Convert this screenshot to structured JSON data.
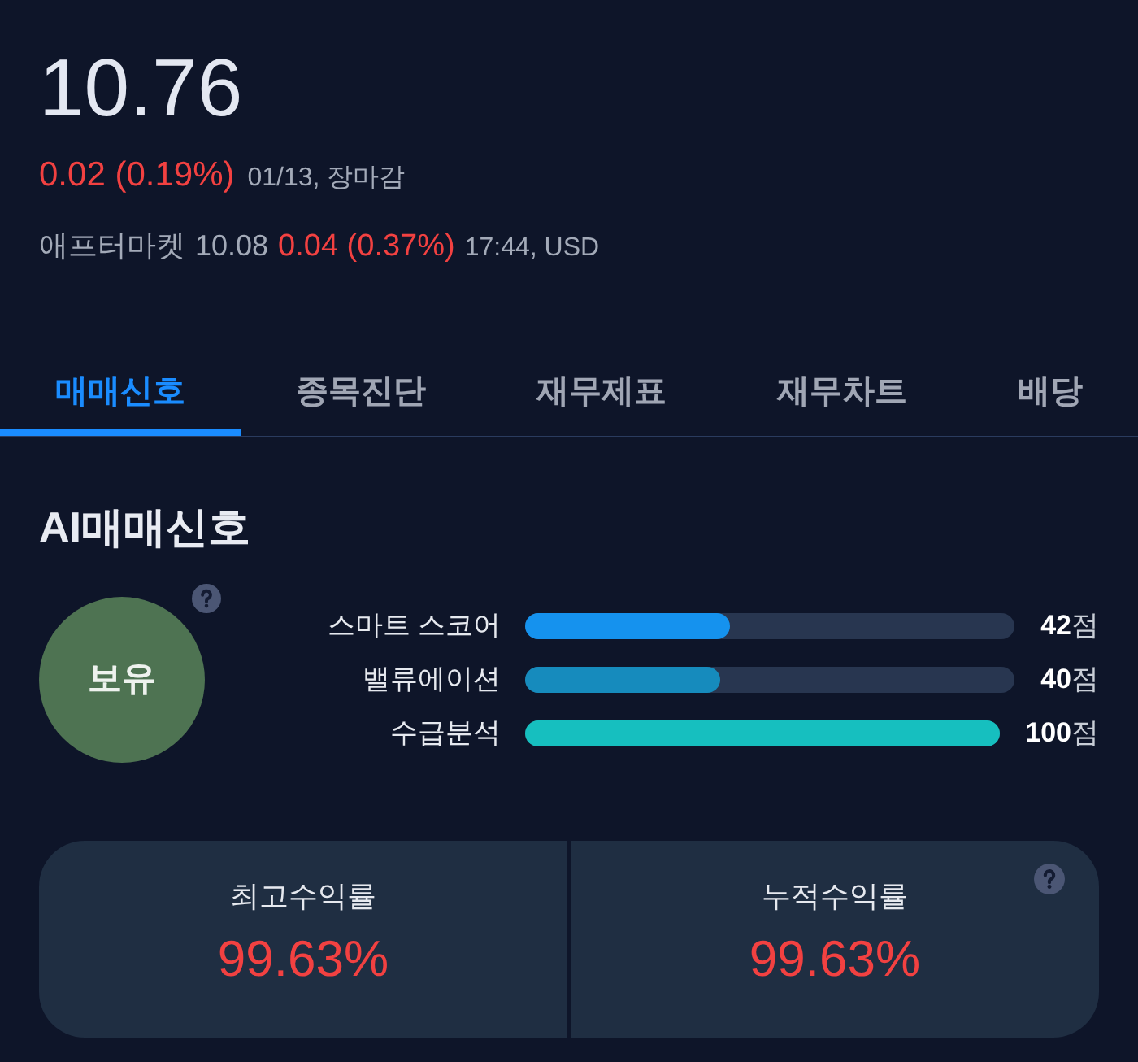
{
  "quote": {
    "price": "10.76",
    "change": "0.02 (0.19%)",
    "date_status": "01/13, 장마감"
  },
  "after_market": {
    "label": "애프터마켓",
    "price": "10.08",
    "change": "0.04 (0.37%)",
    "time_currency": "17:44, USD"
  },
  "tabs": [
    {
      "label": "매매신호",
      "selected": true
    },
    {
      "label": "종목진단",
      "selected": false
    },
    {
      "label": "재무제표",
      "selected": false
    },
    {
      "label": "재무차트",
      "selected": false
    },
    {
      "label": "배당",
      "selected": false
    }
  ],
  "signal": {
    "title": "AI매매신호",
    "verdict": "보유",
    "help": true,
    "scores": [
      {
        "label": "스마트 스코어",
        "level": 0.42,
        "score": "**42**점",
        "color": "#1592ee"
      },
      {
        "label": "밸류에이션",
        "level": 0.4,
        "score": "**40**점",
        "color": "#168bbd"
      },
      {
        "label": "수급분석",
        "level": 1,
        "score": "**100**점",
        "color": "#16bfbf"
      }
    ]
  },
  "returns": [
    {
      "label": "최고수익률",
      "value": "99.63%",
      "help": false
    },
    {
      "label": "누적수익률",
      "value": "99.63%",
      "help": true
    }
  ]
}
